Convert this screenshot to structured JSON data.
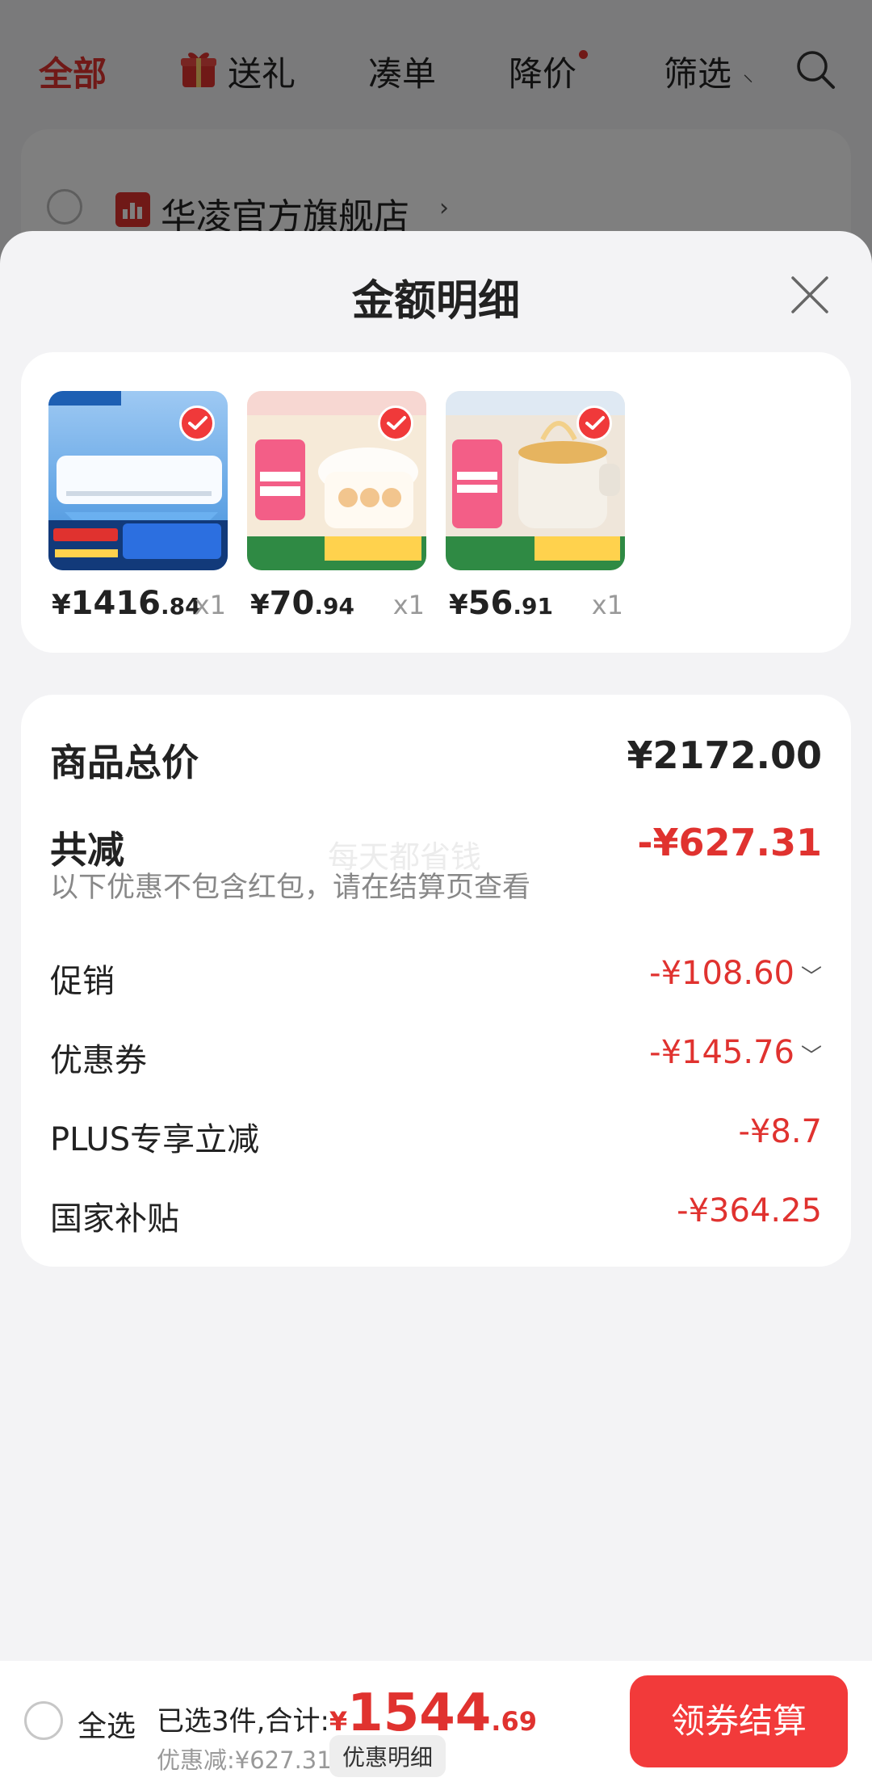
{
  "nav": {
    "tabs": [
      "全部",
      "送礼",
      "凑单",
      "降价",
      "筛选"
    ]
  },
  "store": {
    "name": "华凌官方旗舰店"
  },
  "sheet": {
    "title": "金额明细",
    "products": [
      {
        "yen": "¥",
        "int": "1416",
        "dec": ".84",
        "qty": "x1"
      },
      {
        "yen": "¥",
        "int": "70",
        "dec": ".94",
        "qty": "x1"
      },
      {
        "yen": "¥",
        "int": "56",
        "dec": ".91",
        "qty": "x1"
      }
    ],
    "summary": {
      "total_label": "商品总价",
      "total_value": "¥2172.00",
      "reduce_label": "共减",
      "reduce_value": "-¥627.31",
      "hint": "以下优惠不包含红包，请在结算页查看",
      "watermark": "每天都省钱",
      "rows": [
        {
          "label": "促销",
          "value": "-¥108.60"
        },
        {
          "label": "优惠券",
          "value": "-¥145.76"
        },
        {
          "label": "PLUS专享立减",
          "value": "-¥8.7"
        },
        {
          "label": "国家补贴",
          "value": "-¥364.25"
        }
      ]
    }
  },
  "bottom": {
    "select_all": "全选",
    "summary_text": "已选3件,合计:",
    "total_yen": "¥",
    "total_int": "1544",
    "total_dec": ".69",
    "discount_text": "优惠减:¥627.31",
    "detail_button": "优惠明细",
    "checkout_button": "领券结算"
  },
  "colors": {
    "accent": "#e0322f",
    "checkout": "#f23a3a"
  }
}
